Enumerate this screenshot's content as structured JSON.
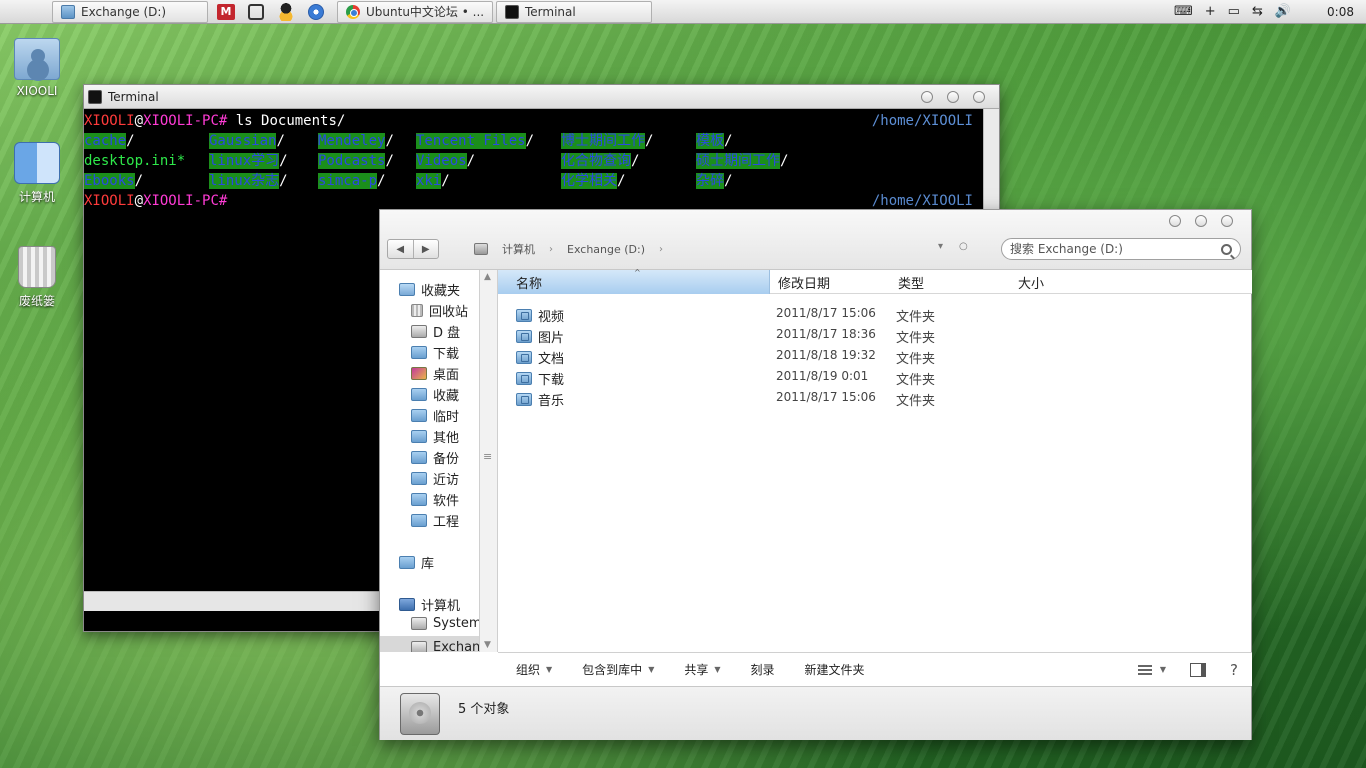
{
  "taskbar": {
    "apple": "",
    "tasks": [
      {
        "label": "Exchange (D:)"
      },
      {
        "label": "Ubuntu中文论坛 • ..."
      },
      {
        "label": "Terminal"
      }
    ],
    "quick_launch": {
      "m_label": "M"
    },
    "tray": {
      "plus": "+",
      "clock": "0:08"
    }
  },
  "desktop": {
    "icons": [
      {
        "label": "XIOOLI"
      },
      {
        "label": "计算机"
      },
      {
        "label": "废纸篓"
      }
    ]
  },
  "terminal": {
    "title": "Terminal",
    "user": "XIOOLI",
    "at": "@",
    "host": "XIOOLI-PC#",
    "command": " ls Documents/",
    "path": "/home/XIOOLI",
    "rows": [
      [
        "cache",
        "Gaussian",
        "Mendeley",
        "Tencent Files",
        "博士期间工作",
        "模板"
      ],
      [
        "desktop.ini*",
        "linux学习",
        "Podcasts",
        "Videos",
        "化合物查询",
        "硕士期间工作"
      ],
      [
        "Ebooks",
        "linux杂志",
        "simca-p",
        "xki",
        "化学相关",
        "杂碎"
      ]
    ],
    "slash": "/"
  },
  "explorer": {
    "breadcrumb": [
      "计算机",
      "Exchange (D:)"
    ],
    "crumb_sep": "›",
    "addr_tools": [
      "▾",
      "○"
    ],
    "search_placeholder": "搜索 Exchange (D:)",
    "sidebar": [
      {
        "label": "收藏夹"
      },
      {
        "label": "回收站"
      },
      {
        "label": "D 盘"
      },
      {
        "label": "下载"
      },
      {
        "label": "桌面"
      },
      {
        "label": "收藏"
      },
      {
        "label": "临时"
      },
      {
        "label": "其他"
      },
      {
        "label": "备份"
      },
      {
        "label": "近访"
      },
      {
        "label": "软件"
      },
      {
        "label": "工程"
      },
      {
        "label": "库"
      },
      {
        "label": "计算机"
      },
      {
        "label": "System"
      },
      {
        "label": "Exchang"
      }
    ],
    "columns": {
      "name": "名称",
      "date": "修改日期",
      "type": "类型",
      "size": "大小"
    },
    "files": [
      {
        "name": "视频",
        "date": "2011/8/17 15:06",
        "type": "文件夹"
      },
      {
        "name": "图片",
        "date": "2011/8/17 18:36",
        "type": "文件夹"
      },
      {
        "name": "文档",
        "date": "2011/8/18 19:32",
        "type": "文件夹"
      },
      {
        "name": "下载",
        "date": "2011/8/19 0:01",
        "type": "文件夹"
      },
      {
        "name": "音乐",
        "date": "2011/8/17 15:06",
        "type": "文件夹"
      }
    ],
    "toolbar": {
      "organize": "组织",
      "include": "包含到库中",
      "share": "共享",
      "burn": "刻录",
      "new_folder": "新建文件夹",
      "help": "?"
    },
    "status": "5 个对象"
  }
}
